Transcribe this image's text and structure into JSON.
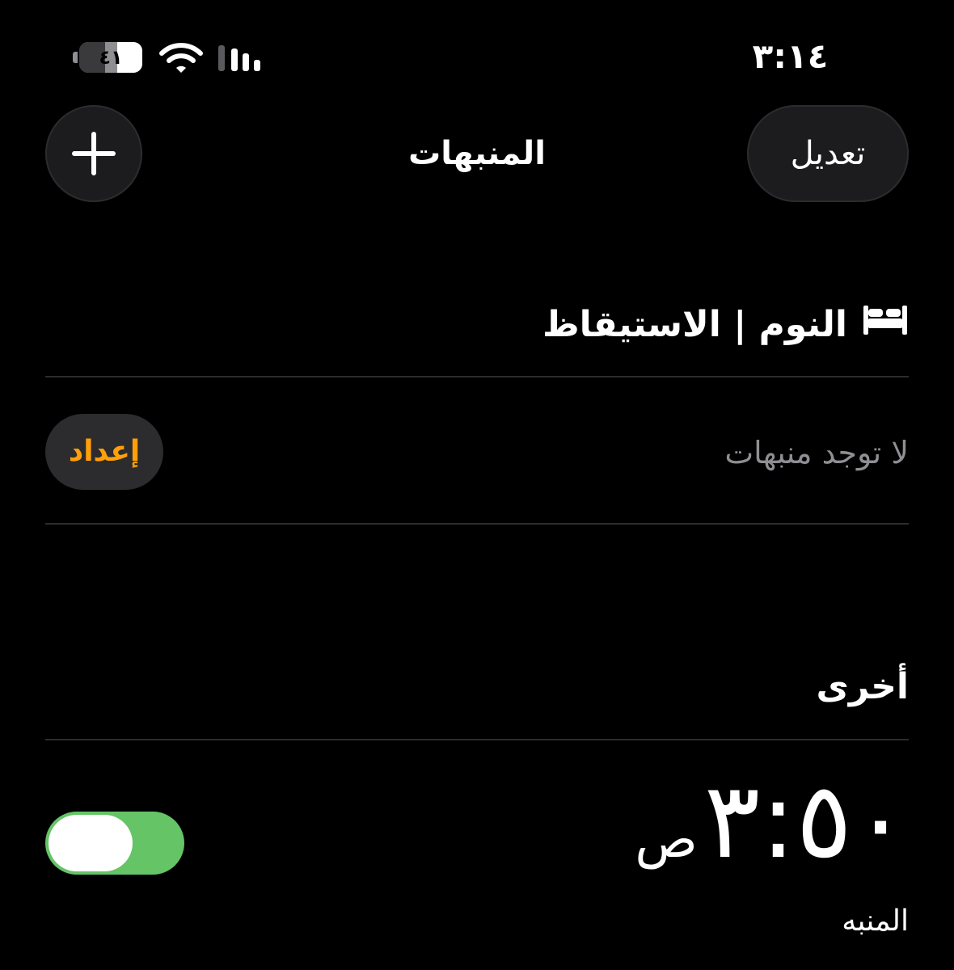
{
  "status_bar": {
    "time": "٣:١٤",
    "battery_level": "٤١"
  },
  "nav": {
    "title": "المنبهات",
    "edit_label": "تعديل",
    "add_icon": "plus-icon"
  },
  "sleep_section": {
    "icon": "bed-icon",
    "title": "النوم | الاستيقاظ",
    "empty_text": "لا توجد منبهات",
    "setup_label": "إعداد"
  },
  "other_section": {
    "title": "أخرى",
    "alarms": [
      {
        "time": "٣:٥٠",
        "ampm": "ص",
        "label": "المنبه",
        "enabled": true
      }
    ]
  },
  "colors": {
    "background": "#000000",
    "accent_orange": "#ff9f0a",
    "toggle_on": "#65c466",
    "secondary_text": "#8e8e93"
  }
}
